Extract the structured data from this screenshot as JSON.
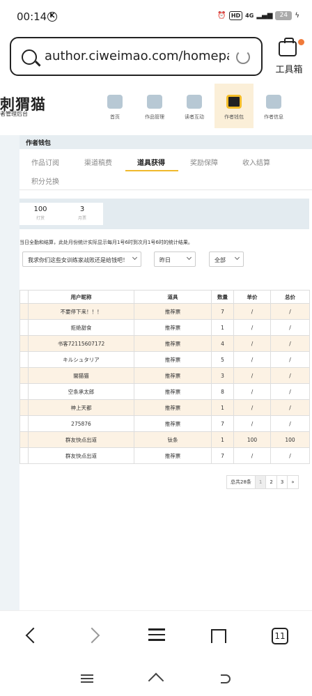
{
  "status_bar": {
    "time": "00:14",
    "k_icon": "K",
    "hd": "HD",
    "net": "4G",
    "battery": "24"
  },
  "browser": {
    "url": "author.ciweimao.com/homepa•••",
    "toolbox_label": "工具箱"
  },
  "site": {
    "logo_text": "刺猬猫",
    "logo_sub": "者管理后台",
    "nav": [
      {
        "label": "首页",
        "icon": "home-icon"
      },
      {
        "label": "作品管理",
        "icon": "book-icon"
      },
      {
        "label": "读者互动",
        "icon": "chat-icon"
      },
      {
        "label": "作者钱包",
        "icon": "wallet-icon"
      },
      {
        "label": "作者信息",
        "icon": "profile-icon"
      }
    ]
  },
  "wallet": {
    "header": "作者钱包",
    "tabs": [
      "作品订阅",
      "渠道稿费",
      "道具获得",
      "奖励保障",
      "收入结算",
      "积分兑换"
    ],
    "active_tab": "道具获得",
    "stats": [
      {
        "value": "100",
        "label": "打赏"
      },
      {
        "value": "3",
        "label": "月票"
      }
    ],
    "notice": "当日全勤和结算，此处月份统计实际显示每月1号6时到次月1号6时的统计结果。",
    "filters": {
      "book": "我求你们这些女训练家战败还是给钱吧！",
      "date": "昨日",
      "type": "全部"
    },
    "table": {
      "headers": [
        "用户昵称",
        "道具",
        "数量",
        "单价",
        "总价"
      ],
      "rows": [
        [
          "不要停下来！！！",
          "推荐票",
          "7",
          "/",
          "/"
        ],
        [
          "拒绝甜食",
          "推荐票",
          "1",
          "/",
          "/"
        ],
        [
          "书客72115607172",
          "推荐票",
          "4",
          "/",
          "/"
        ],
        [
          "キルシュタリア",
          "推荐票",
          "5",
          "/",
          "/"
        ],
        [
          "闇猫猫",
          "推荐票",
          "3",
          "/",
          "/"
        ],
        [
          "空条承太郎",
          "推荐票",
          "8",
          "/",
          "/"
        ],
        [
          "神上天都",
          "推荐票",
          "1",
          "/",
          "/"
        ],
        [
          "275876",
          "推荐票",
          "7",
          "/",
          "/"
        ],
        [
          "群友快点出道",
          "钛条",
          "1",
          "100",
          "100"
        ],
        [
          "群友快点出道",
          "推荐票",
          "7",
          "/",
          "/"
        ]
      ]
    },
    "pagination": {
      "total": "总共28条",
      "pages": [
        "1",
        "2",
        "3",
        "»"
      ],
      "current": "1"
    }
  },
  "bottom_nav": {
    "tabs_count": "11"
  }
}
